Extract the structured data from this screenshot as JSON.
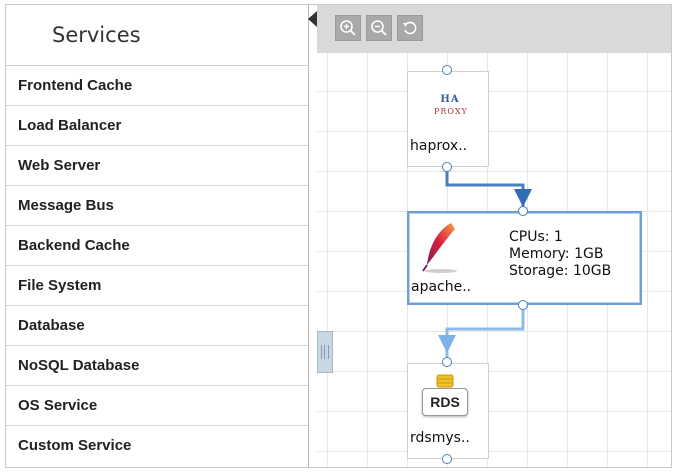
{
  "sidebar": {
    "title": "Services",
    "items": [
      {
        "label": "Frontend Cache"
      },
      {
        "label": "Load Balancer"
      },
      {
        "label": "Web Server"
      },
      {
        "label": "Message Bus"
      },
      {
        "label": "Backend Cache"
      },
      {
        "label": "File System"
      },
      {
        "label": "Database"
      },
      {
        "label": "NoSQL Database"
      },
      {
        "label": "OS Service"
      },
      {
        "label": "Custom Service"
      }
    ]
  },
  "toolbar": {
    "buttons": [
      {
        "icon": "zoom-in-icon"
      },
      {
        "icon": "zoom-out-icon"
      },
      {
        "icon": "reset-icon"
      }
    ]
  },
  "nodes": {
    "haproxy": {
      "label": "haprox..",
      "logo_line1": "HA",
      "logo_line2": "PROXY"
    },
    "apache": {
      "label": "apache..",
      "cpus": "CPUs: 1",
      "memory": "Memory: 1GB",
      "storage": "Storage: 10GB"
    },
    "rds": {
      "label": "rdsmys..",
      "badge": "RDS"
    }
  },
  "colors": {
    "accent": "#4a7fc0",
    "connector": "#6aa7e0",
    "selected_border": "#6aa0d8",
    "toolbar_bg": "#d9d9d9",
    "button_bg": "#a9a9a9"
  }
}
